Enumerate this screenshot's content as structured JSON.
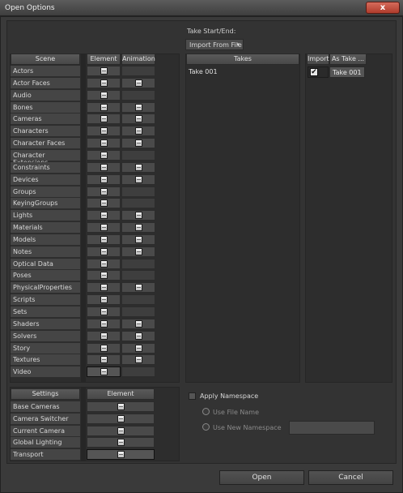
{
  "window": {
    "title": "Open Options",
    "close_label": "x"
  },
  "take_start_end": {
    "label": "Take Start/End:",
    "value": "Import From File"
  },
  "scene_table": {
    "headers": {
      "scene": "Scene",
      "element": "Element",
      "animation": "Animation"
    },
    "rows": [
      {
        "label": "Actors",
        "element": true,
        "animation": false
      },
      {
        "label": "Actor Faces",
        "element": true,
        "animation": true
      },
      {
        "label": "Audio",
        "element": true,
        "animation": false
      },
      {
        "label": "Bones",
        "element": true,
        "animation": true
      },
      {
        "label": "Cameras",
        "element": true,
        "animation": true
      },
      {
        "label": "Characters",
        "element": true,
        "animation": true
      },
      {
        "label": "Character Faces",
        "element": true,
        "animation": true
      },
      {
        "label": "Character Extensions",
        "element": true,
        "animation": false
      },
      {
        "label": "Constraints",
        "element": true,
        "animation": true
      },
      {
        "label": "Devices",
        "element": true,
        "animation": true
      },
      {
        "label": "Groups",
        "element": true,
        "animation": false
      },
      {
        "label": "KeyingGroups",
        "element": true,
        "animation": false
      },
      {
        "label": "Lights",
        "element": true,
        "animation": true
      },
      {
        "label": "Materials",
        "element": true,
        "animation": true
      },
      {
        "label": "Models",
        "element": true,
        "animation": true
      },
      {
        "label": "Notes",
        "element": true,
        "animation": true
      },
      {
        "label": "Optical Data",
        "element": true,
        "animation": false
      },
      {
        "label": "Poses",
        "element": true,
        "animation": false
      },
      {
        "label": "PhysicalProperties",
        "element": true,
        "animation": true
      },
      {
        "label": "Scripts",
        "element": true,
        "animation": false
      },
      {
        "label": "Sets",
        "element": true,
        "animation": false
      },
      {
        "label": "Shaders",
        "element": true,
        "animation": true
      },
      {
        "label": "Solvers",
        "element": true,
        "animation": true
      },
      {
        "label": "Story",
        "element": true,
        "animation": true
      },
      {
        "label": "Textures",
        "element": true,
        "animation": true
      },
      {
        "label": "Video",
        "element": true,
        "animation": false
      }
    ]
  },
  "settings_table": {
    "headers": {
      "settings": "Settings",
      "element": "Element"
    },
    "rows": [
      {
        "label": "Base Cameras"
      },
      {
        "label": "Camera Switcher"
      },
      {
        "label": "Current Camera"
      },
      {
        "label": "Global Lighting"
      },
      {
        "label": "Transport"
      }
    ]
  },
  "takes_table": {
    "headers": {
      "takes": "Takes",
      "import": "Import",
      "as_take": "As Take ..."
    },
    "rows": [
      {
        "take": "Take 001",
        "import": "✔",
        "as_take": "Take 001"
      }
    ]
  },
  "namespace": {
    "apply_label": "Apply Namespace",
    "use_file_name": "Use File Name",
    "use_new_namespace": "Use New Namespace"
  },
  "buttons": {
    "open": "Open",
    "cancel": "Cancel"
  }
}
